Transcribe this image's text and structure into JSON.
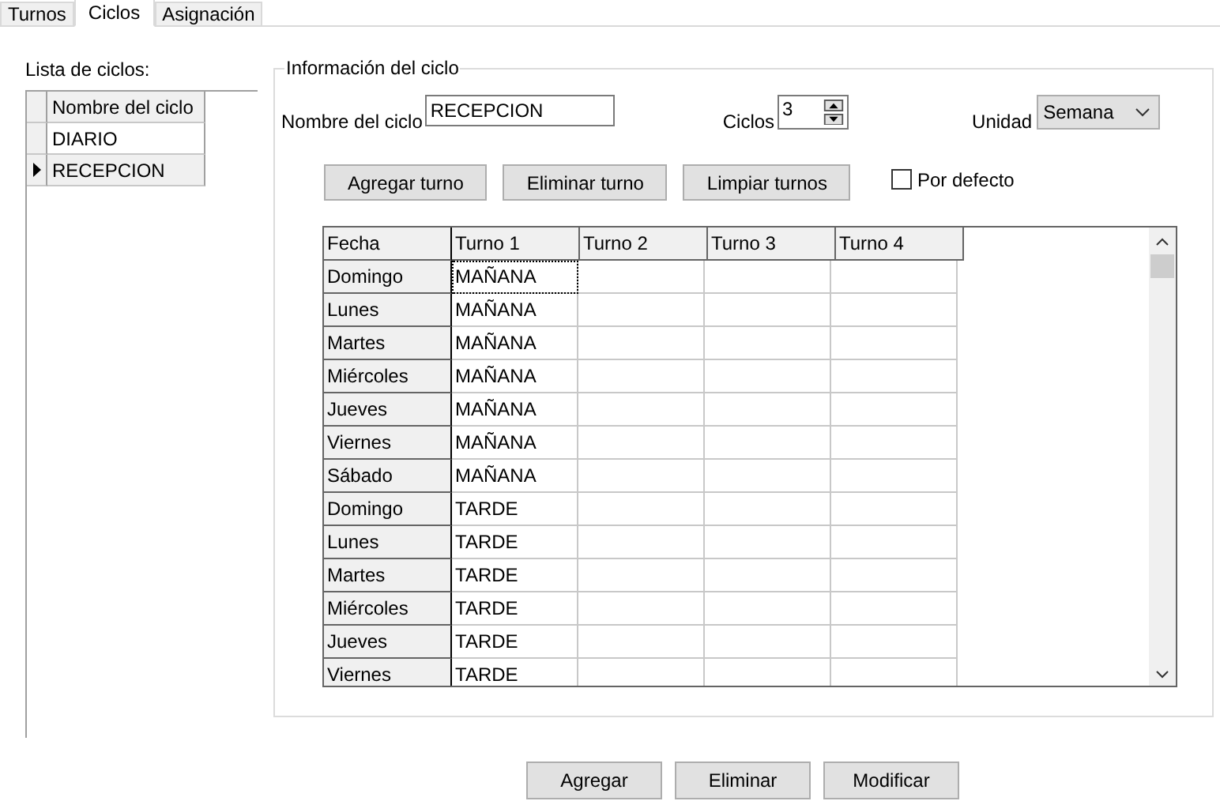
{
  "tabs": [
    {
      "label": "Turnos",
      "selected": false
    },
    {
      "label": "Ciclos",
      "selected": true
    },
    {
      "label": "Asignación",
      "selected": false
    }
  ],
  "cycle_list": {
    "label": "Lista de ciclos:",
    "column": "Nombre del ciclo",
    "rows": [
      {
        "name": "DIARIO",
        "selected": false
      },
      {
        "name": "RECEPCION",
        "selected": true
      }
    ]
  },
  "cycle_info": {
    "title": "Información del ciclo",
    "name_label": "Nombre del ciclo",
    "name_value": "RECEPCION",
    "cycles_label": "Ciclos",
    "cycles_value": "3",
    "unit_label": "Unidad",
    "unit_value": "Semana",
    "buttons": [
      "Agregar turno",
      "Eliminar turno",
      "Limpiar turnos"
    ],
    "default_checkbox": {
      "label": "Por defecto",
      "checked": false
    },
    "table": {
      "columns": [
        "Fecha",
        "Turno 1",
        "Turno 2",
        "Turno 3",
        "Turno 4"
      ],
      "rows": [
        {
          "fecha": "Domingo",
          "turno_1": "MAÑANA",
          "selected": true
        },
        {
          "fecha": "Lunes",
          "turno_1": "MAÑANA",
          "selected": false
        },
        {
          "fecha": "Martes",
          "turno_1": "MAÑANA",
          "selected": false
        },
        {
          "fecha": "Miércoles",
          "turno_1": "MAÑANA",
          "selected": false
        },
        {
          "fecha": "Jueves",
          "turno_1": "MAÑANA",
          "selected": false
        },
        {
          "fecha": "Viernes",
          "turno_1": "MAÑANA",
          "selected": false
        },
        {
          "fecha": "Sábado",
          "turno_1": "MAÑANA",
          "selected": false
        },
        {
          "fecha": "Domingo",
          "turno_1": "TARDE",
          "selected": false
        },
        {
          "fecha": "Lunes",
          "turno_1": "TARDE",
          "selected": false
        },
        {
          "fecha": "Martes",
          "turno_1": "TARDE",
          "selected": false
        },
        {
          "fecha": "Miércoles",
          "turno_1": "TARDE",
          "selected": false
        },
        {
          "fecha": "Jueves",
          "turno_1": "TARDE",
          "selected": false
        },
        {
          "fecha": "Viernes",
          "turno_1": "TARDE",
          "selected": false
        }
      ]
    }
  },
  "buttons": [
    "Agregar",
    "Eliminar",
    "Modificar"
  ]
}
